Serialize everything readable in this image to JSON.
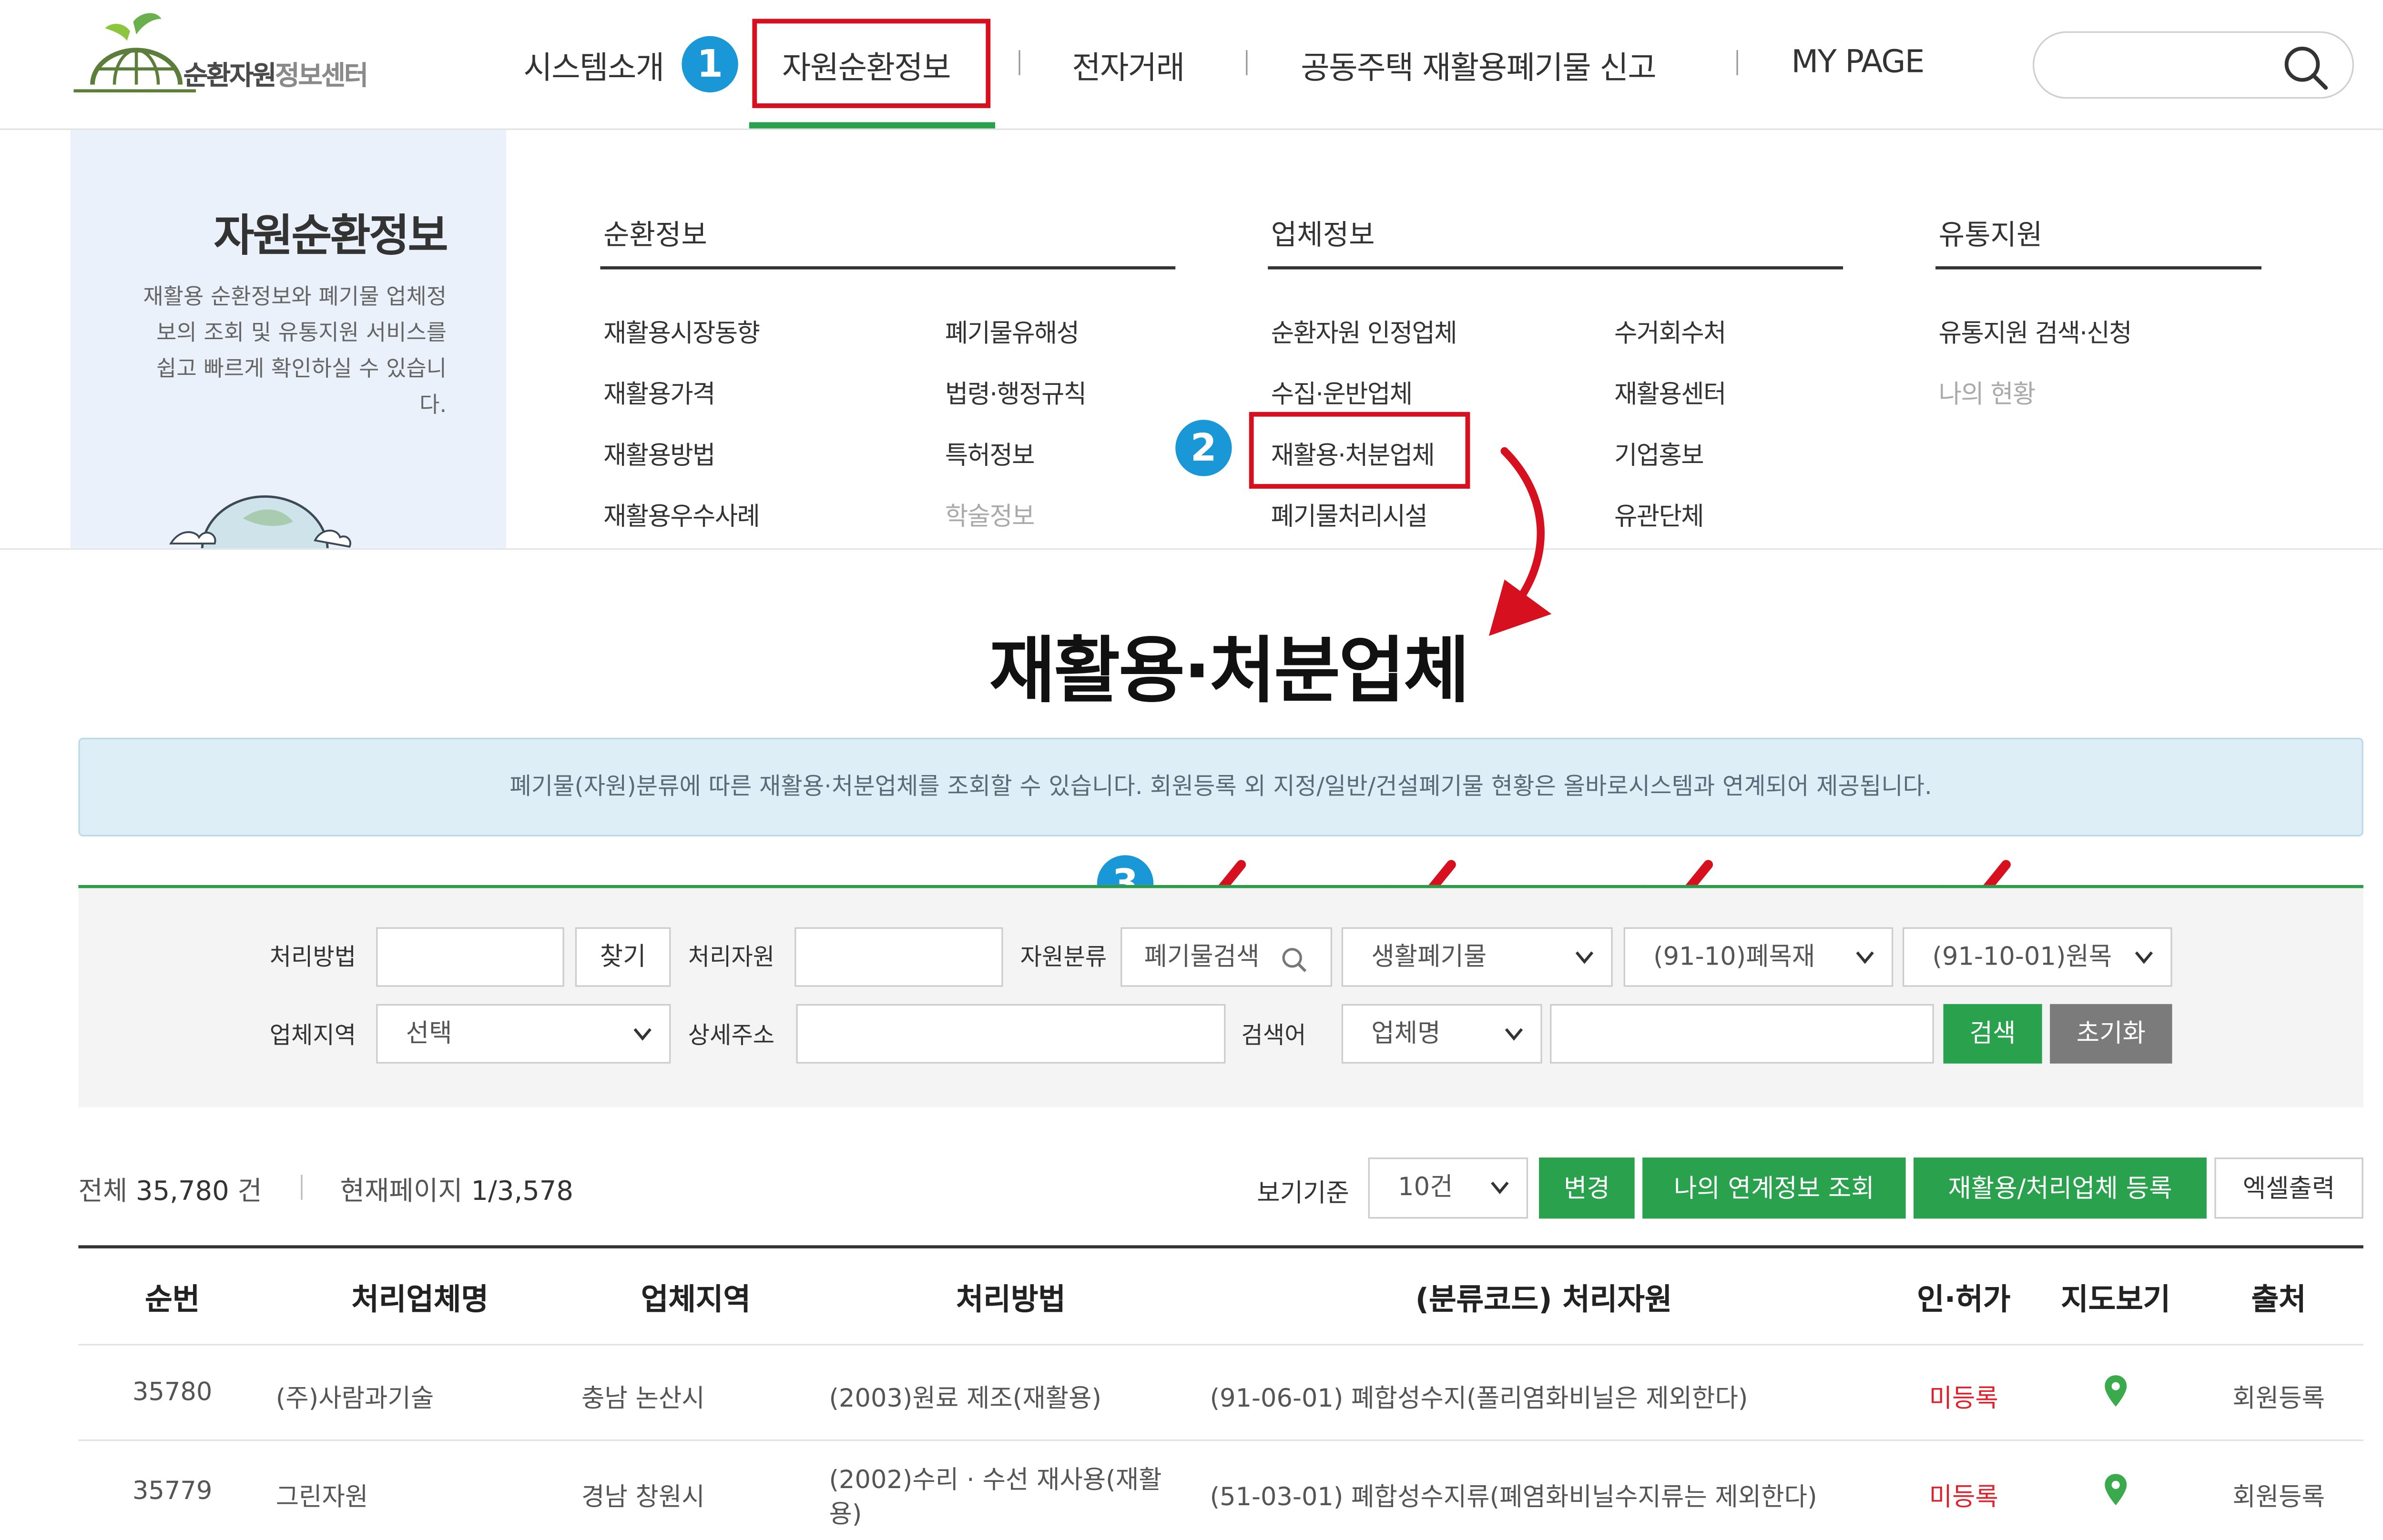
{
  "header": {
    "logo_text_main": "순환자원",
    "logo_text_sub": "정보센터",
    "nav": [
      "시스템소개",
      "자원순환정보",
      "전자거래",
      "공동주택 재활용폐기물 신고",
      "MY PAGE"
    ],
    "search_placeholder": ""
  },
  "step_badges": [
    "1",
    "2",
    "3"
  ],
  "mega_menu": {
    "side_title": "자원순환정보",
    "side_description": "재활용 순환정보와 폐기물 업체정보의 조회 및 유통지원 서비스를 쉽고 빠르게 확인하실 수 있습니다.",
    "columns": [
      {
        "heading": "순환정보",
        "links": [
          "재활용시장동향",
          "재활용가격",
          "재활용방법",
          "재활용우수사례",
          "폐기물유해성",
          "법령·행정규칙",
          "특허정보",
          "학술정보"
        ]
      },
      {
        "heading": "업체정보",
        "links": [
          "순환자원 인정업체",
          "수집·운반업체",
          "재활용·처분업체",
          "폐기물처리시설",
          "수거회수처",
          "재활용센터",
          "기업홍보",
          "유관단체"
        ]
      },
      {
        "heading": "유통지원",
        "links": [
          "유통지원 검색·신청",
          "나의 현황"
        ]
      }
    ]
  },
  "page": {
    "title": "재활용·처분업체",
    "notice": "폐기물(자원)분류에 따른 재활용·처분업체를 조회할 수 있습니다. 회원등록 외 지정/일반/건설폐기물 현황은 올바로시스템과 연계되어 제공됩니다."
  },
  "filters": {
    "method_label": "처리방법",
    "method_value": "",
    "find_button": "찾기",
    "resource_label": "처리자원",
    "resource_value": "",
    "category_label": "자원분류",
    "waste_search": "폐기물검색",
    "category_select_1": "생활폐기물",
    "category_select_2": "(91-10)폐목재",
    "category_select_3": "(91-10-01)원목",
    "region_label": "업체지역",
    "region_select": "선택",
    "address_label": "상세주소",
    "address_value": "",
    "keyword_label": "검색어",
    "keyword_select": "업체명",
    "keyword_value": "",
    "search_button": "검색",
    "reset_button": "초기화"
  },
  "list_controls": {
    "total_label": "전체",
    "total_value": "35,780",
    "total_unit": "건",
    "page_label": "현재페이지",
    "page_value": "1/3,578",
    "view_label": "보기기준",
    "view_select": "10건",
    "change_button": "변경",
    "link_info_button": "나의 연계정보 조회",
    "register_button": "재활용/처리업체 등록",
    "excel_button": "엑셀출력"
  },
  "table": {
    "columns": [
      "순번",
      "처리업체명",
      "업체지역",
      "처리방법",
      "(분류코드) 처리자원",
      "인·허가",
      "지도보기",
      "출처"
    ],
    "rows": [
      {
        "no": "35780",
        "name": "(주)사람과기술",
        "region": "충남 논산시",
        "method": "(2003)원료 제조(재활용)",
        "method_line2": "",
        "resource": "(91-06-01) 폐합성수지(폴리염화비닐은 제외한다)",
        "permit": "미등록",
        "source": "회원등록"
      },
      {
        "no": "35779",
        "name": "그린자원",
        "region": "경남 창원시",
        "method": "(2002)수리 · 수선 재사용(재활",
        "method_line2": "용)",
        "resource": "(51-03-01) 폐합성수지류(폐염화비닐수지류는 제외한다)",
        "permit": "미등록",
        "source": "회원등록"
      }
    ]
  },
  "colors": {
    "accent_red": "#d6101e",
    "badge_blue": "#1a97d6",
    "brand_green": "#2aa14d",
    "notice_bg": "#deeef6"
  }
}
